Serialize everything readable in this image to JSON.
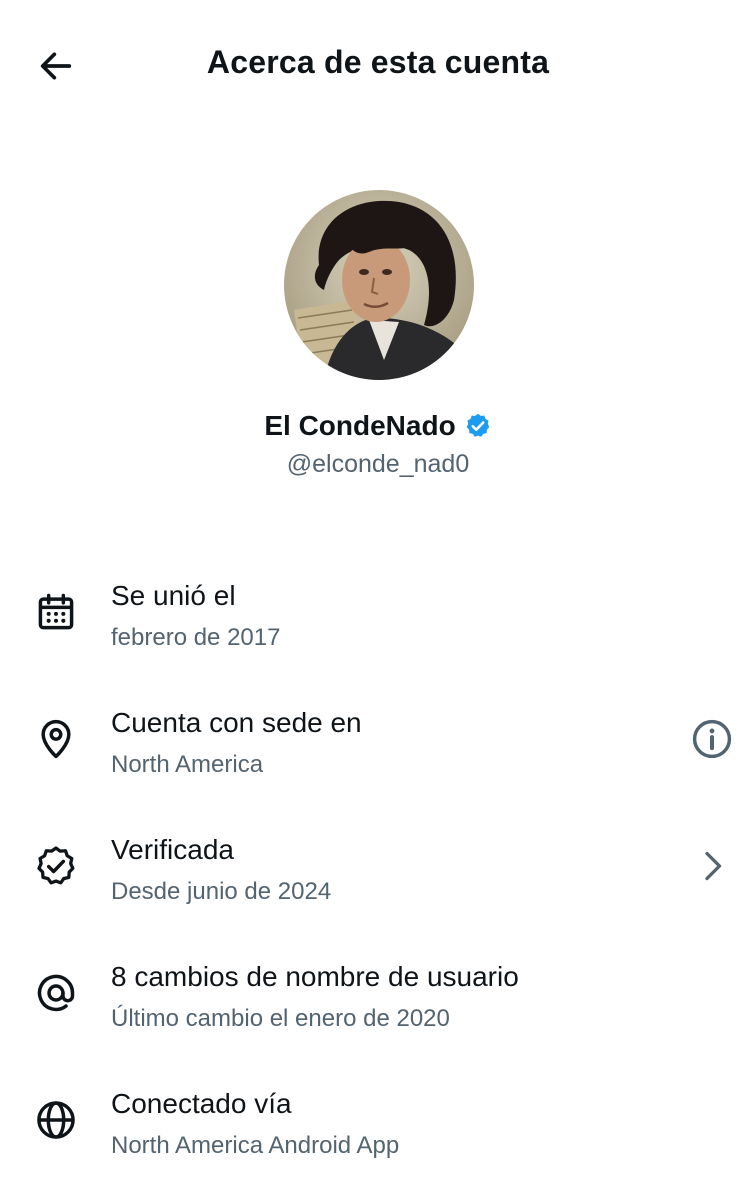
{
  "header": {
    "title": "Acerca de esta cuenta",
    "back_icon": "arrow-left-icon"
  },
  "profile": {
    "name": "El CondeNado",
    "handle": "@elconde_nad0",
    "verified_color": "#1d9bf0"
  },
  "items": [
    {
      "icon": "calendar-icon",
      "primary": "Se unió el",
      "secondary": "febrero de 2017"
    },
    {
      "icon": "location-pin-icon",
      "primary": "Cuenta con sede en",
      "secondary": "North America",
      "trailing_icon": "info-icon"
    },
    {
      "icon": "verified-seal-icon",
      "primary": "Verificada",
      "secondary": "Desde junio de 2024",
      "trailing_icon": "chevron-right-icon"
    },
    {
      "icon": "at-sign-icon",
      "primary": "8 cambios de nombre de usuario",
      "secondary": "Último cambio el enero de 2020"
    },
    {
      "icon": "globe-icon",
      "primary": "Conectado vía",
      "secondary": "North America Android App"
    }
  ],
  "colors": {
    "text": "#0f1419",
    "secondary_text": "#536471",
    "accent": "#1d9bf0"
  }
}
